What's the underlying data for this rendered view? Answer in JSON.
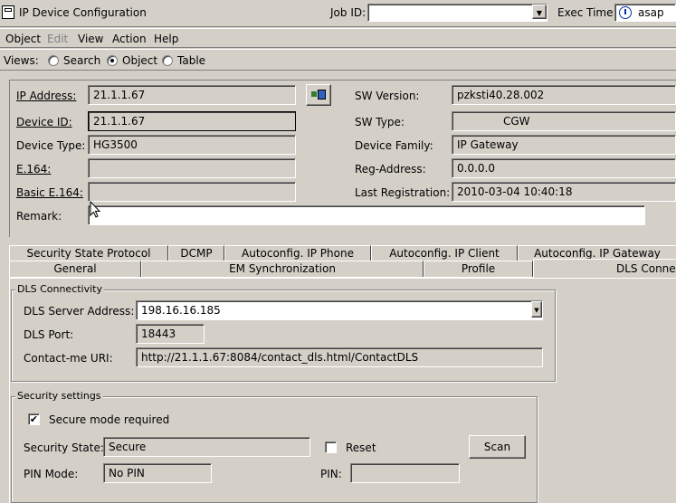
{
  "window": {
    "title": "IP Device Configuration"
  },
  "toolbar": {
    "job_id_label": "Job ID:",
    "job_id_value": "",
    "exec_time_label": "Exec Time:",
    "exec_time_value": "asap"
  },
  "menu": [
    "Object",
    "Edit",
    "View",
    "Action",
    "Help"
  ],
  "views": {
    "label": "Views:",
    "options": [
      "Search",
      "Object",
      "Table"
    ],
    "selected": "Object"
  },
  "device": {
    "ip_address_label": "IP Address:",
    "ip_address": "21.1.1.67",
    "device_id_label": "Device ID:",
    "device_id": "21.1.1.67",
    "device_type_label": "Device Type:",
    "device_type": "HG3500",
    "e164_label": "E.164:",
    "e164": "",
    "basic_e164_label": "Basic E.164:",
    "basic_e164": "",
    "remark_label": "Remark:",
    "remark": "",
    "sw_version_label": "SW Version:",
    "sw_version": "pzksti40.28.002",
    "sw_type_label": "SW Type:",
    "sw_type": "CGW",
    "device_family_label": "Device Family:",
    "device_family": "IP Gateway",
    "reg_address_label": "Reg-Address:",
    "reg_address": "0.0.0.0",
    "last_registration_label": "Last Registration:",
    "last_registration": "2010-03-04 10:40:18"
  },
  "tabs_row1": [
    "Security State Protocol",
    "DCMP",
    "Autoconfig. IP Phone",
    "Autoconfig. IP Client",
    "Autoconfig. IP Gateway"
  ],
  "tabs_row2": [
    "General",
    "EM Synchronization",
    "Profile",
    "DLS Connectivity"
  ],
  "dls": {
    "group_title": "DLS Connectivity",
    "server_label": "DLS Server Address:",
    "server": "198.16.16.185",
    "port_label": "DLS Port:",
    "port": "18443",
    "uri_label": "Contact-me URI:",
    "uri": "http://21.1.1.67:8084/contact_dls.html/ContactDLS"
  },
  "security": {
    "group_title": "Security settings",
    "secure_mode_label": "Secure mode required",
    "secure_mode_checked": "✔",
    "state_label": "Security State:",
    "state": "Secure",
    "reset_label": "Reset",
    "scan_label": "Scan",
    "pin_mode_label": "PIN Mode:",
    "pin_mode": "No PIN",
    "pin_label": "PIN:",
    "pin": ""
  }
}
